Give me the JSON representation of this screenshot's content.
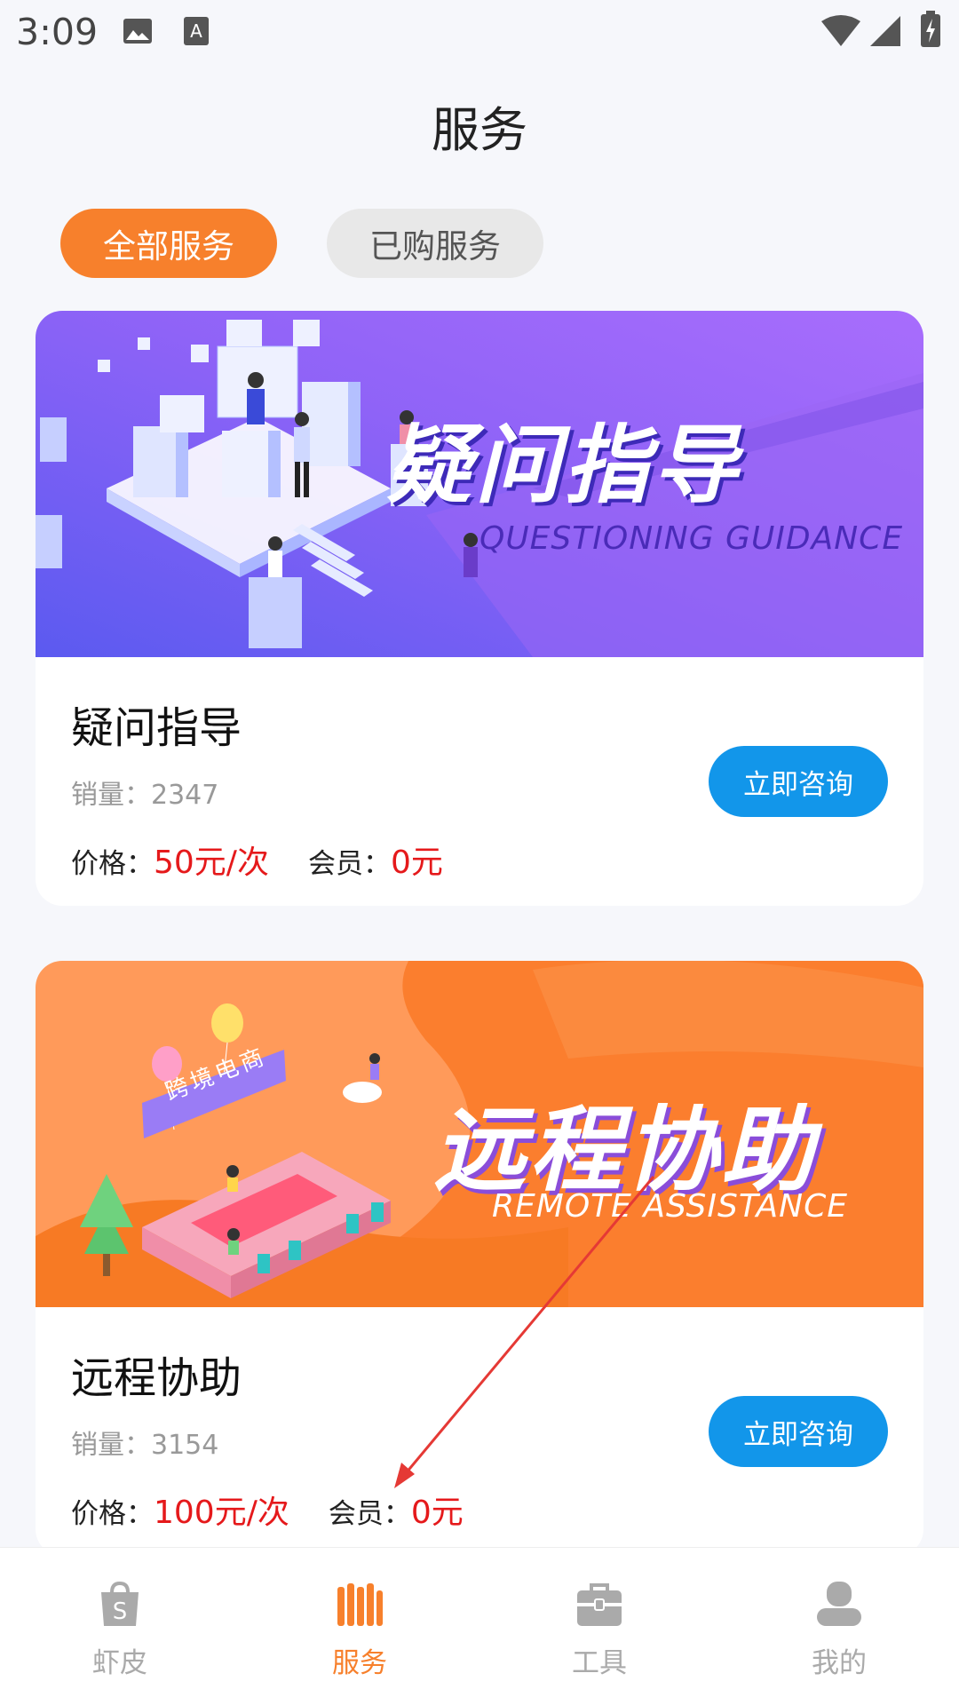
{
  "status_bar": {
    "time": "3:09",
    "icons": [
      "image-icon",
      "font-a-icon",
      "wifi-icon",
      "signal-icon",
      "battery-charging-icon"
    ]
  },
  "header": {
    "title": "服务"
  },
  "tabs": [
    {
      "label": "全部服务",
      "active": true
    },
    {
      "label": "已购服务",
      "active": false
    }
  ],
  "services": [
    {
      "banner_title": "疑问指导",
      "banner_subtitle": "QUESTIONING GUIDANCE",
      "name": "疑问指导",
      "sales_label": "销量：",
      "sales_value": "2347",
      "price_label": "价格：",
      "price_value": "50元/次",
      "member_label": "会员：",
      "member_value": "0元",
      "button_label": "立即咨询"
    },
    {
      "banner_title": "远程协助",
      "banner_subtitle": "REMOTE ASSISTANCE",
      "banner_sign": "跨境电商",
      "name": "远程协助",
      "sales_label": "销量：",
      "sales_value": "3154",
      "price_label": "价格：",
      "price_value": "100元/次",
      "member_label": "会员：",
      "member_value": "0元",
      "button_label": "立即咨询"
    }
  ],
  "bottom_nav": [
    {
      "label": "虾皮",
      "icon": "shopping-bag-icon",
      "active": false
    },
    {
      "label": "服务",
      "icon": "books-icon",
      "active": true
    },
    {
      "label": "工具",
      "icon": "toolbox-icon",
      "active": false
    },
    {
      "label": "我的",
      "icon": "user-icon",
      "active": false
    }
  ],
  "colors": {
    "accent": "#f7802c",
    "button_blue": "#1296ea",
    "price_red": "#e5191b",
    "nav_inactive": "#aaaaaa",
    "annotation_red": "#e53935"
  }
}
